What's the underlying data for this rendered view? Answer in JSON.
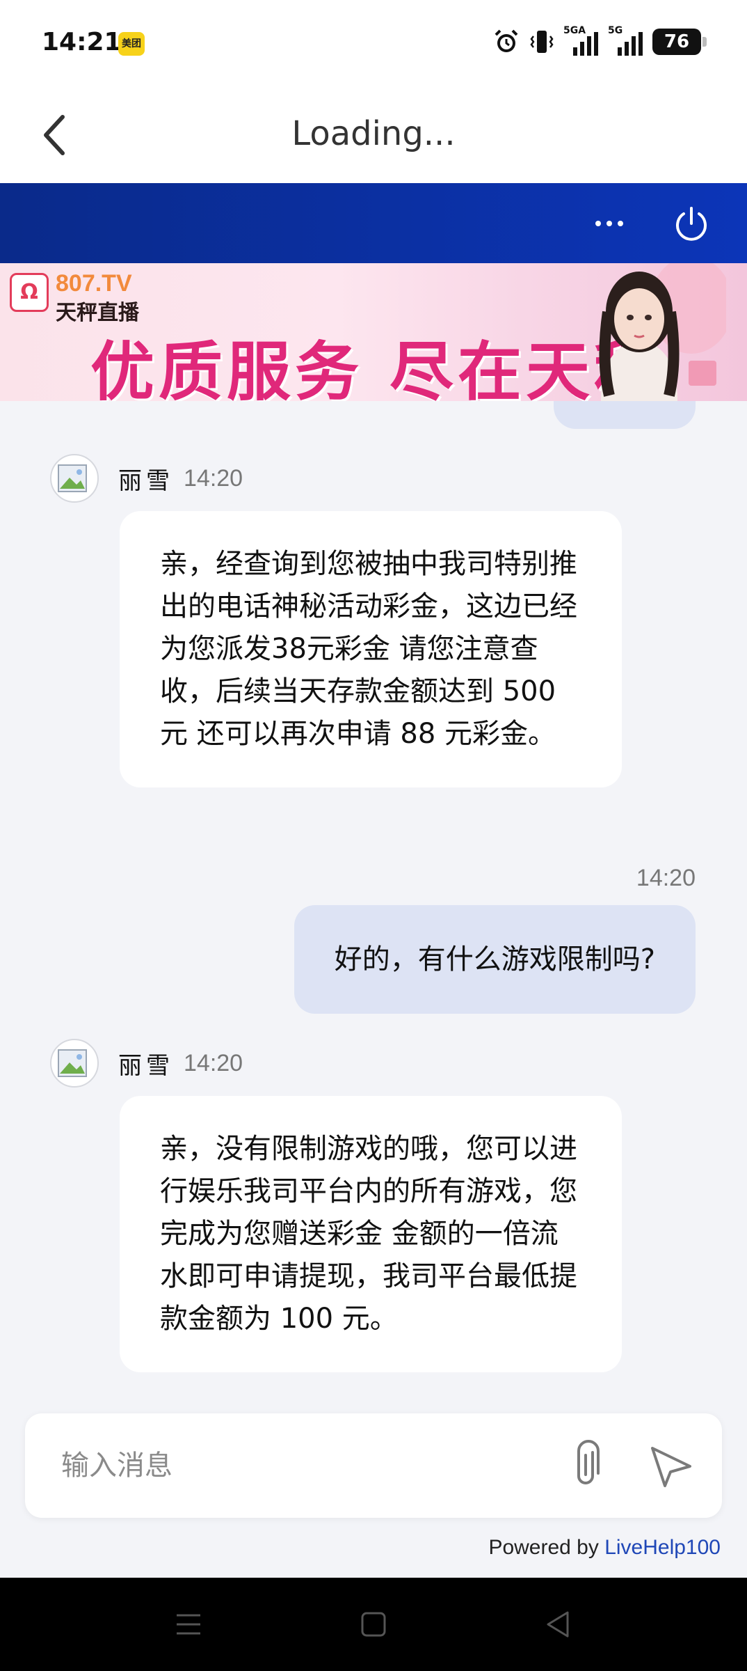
{
  "status_bar": {
    "time": "14:21",
    "app_badge": "美团",
    "signal1_label": "5GA",
    "signal2_label": "5G",
    "battery": "76"
  },
  "nav": {
    "title": "Loading..."
  },
  "banner": {
    "logo_symbol": "Ω",
    "brand": "807.TV",
    "brand_sub": "天秤直播",
    "slogan": "优质服务 尽在天秤"
  },
  "messages": [
    {
      "sender": "agent",
      "name": "丽雪",
      "time": "14:20",
      "text": "亲，经查询到您被抽中我司特别推出的电话神秘活动彩金，这边已经为您派发38元彩金 请您注意查收，后续当天存款金额达到 500 元 还可以再次申请 88 元彩金。"
    },
    {
      "sender": "user",
      "time": "14:20",
      "text": "好的，有什么游戏限制吗?"
    },
    {
      "sender": "agent",
      "name": "丽雪",
      "time": "14:20",
      "text": "亲，没有限制游戏的哦，您可以进行娱乐我司平台内的所有游戏，您完成为您赠送彩金 金额的一倍流水即可申请提现，我司平台最低提款金额为 100 元。"
    }
  ],
  "composer": {
    "placeholder": "输入消息"
  },
  "footer": {
    "powered_prefix": "Powered by ",
    "powered_brand": "LiveHelp100"
  },
  "colors": {
    "header_blue": "#0c35b8",
    "user_bubble": "#dde3f4",
    "link_blue": "#1f47b7"
  }
}
